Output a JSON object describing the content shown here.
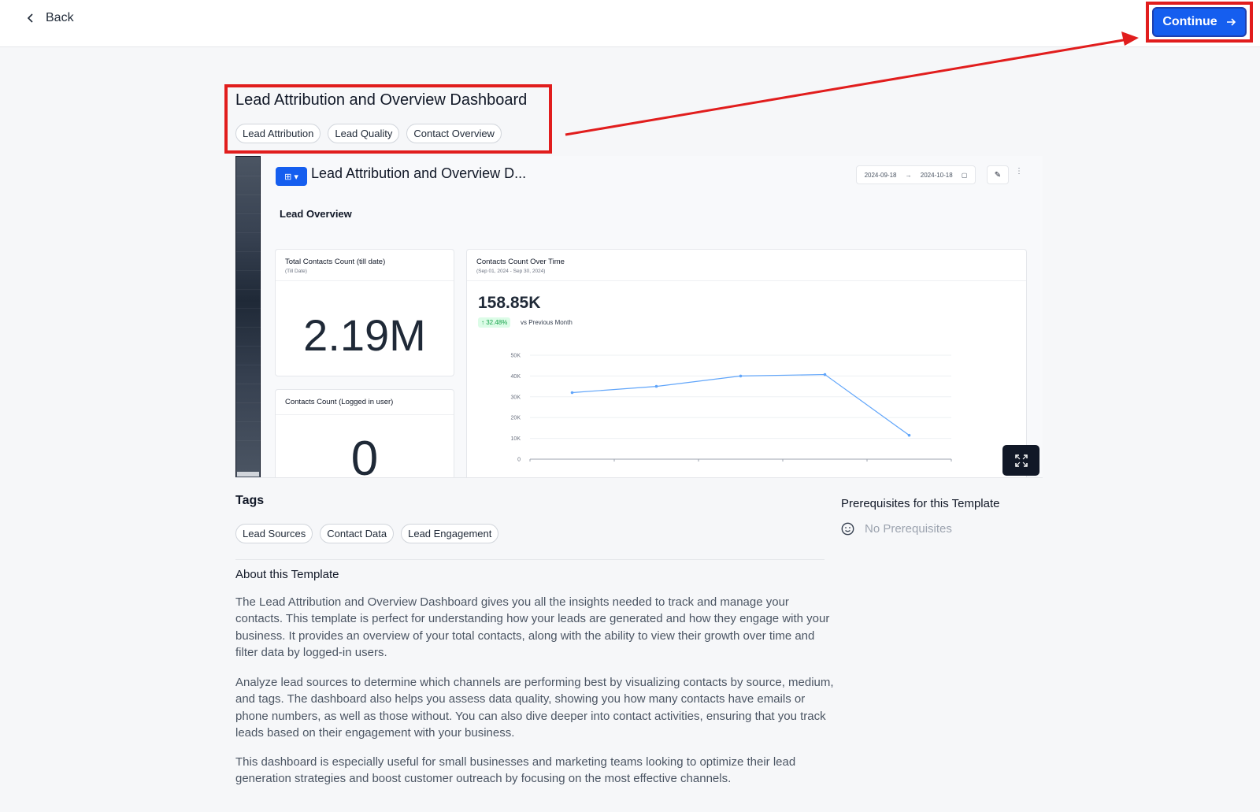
{
  "header": {
    "back_label": "Back",
    "continue_label": "Continue"
  },
  "template": {
    "title": "Lead Attribution and Overview Dashboard",
    "categories": [
      "Lead Attribution",
      "Lead Quality",
      "Contact Overview"
    ]
  },
  "preview": {
    "dashboard_title": "Lead Attribution and Overview D...",
    "date_from": "2024-09-18",
    "date_to": "2024-10-18",
    "section_title": "Lead Overview",
    "card_total": {
      "title": "Total Contacts Count (till date)",
      "subtitle": "(Till Date)",
      "value": "2.19M"
    },
    "card_logged": {
      "title": "Contacts Count (Logged in user)",
      "value": "0"
    },
    "card_chart": {
      "title": "Contacts Count Over Time",
      "subtitle": "(Sep 01, 2024 - Sep 30, 2024)",
      "value": "158.85K",
      "change": "↑ 32.48%",
      "change_label": "vs Previous Month"
    }
  },
  "chart_data": {
    "type": "line",
    "x": [
      1,
      2,
      3,
      4,
      5
    ],
    "series": [
      {
        "values": [
          32000,
          35000,
          40000,
          40700,
          11500
        ]
      }
    ],
    "y_ticks": [
      "50K",
      "40K",
      "30K",
      "20K",
      "10K",
      "0"
    ],
    "ylim": [
      0,
      50000
    ],
    "grid": true,
    "color": "#60a5fa"
  },
  "tags": {
    "heading": "Tags",
    "items": [
      "Lead Sources",
      "Contact Data",
      "Lead Engagement"
    ]
  },
  "about": {
    "heading": "About this Template",
    "paragraphs": [
      "The Lead Attribution and Overview Dashboard gives you all the insights needed to track and manage your contacts. This template is perfect for understanding how your leads are generated and how they engage with your business. It provides an overview of your total contacts, along with the ability to view their growth over time and filter data by logged-in users.",
      "Analyze lead sources to determine which channels are performing best by visualizing contacts by source, medium, and tags. The dashboard also helps you assess data quality, showing you how many contacts have emails or phone numbers, as well as those without. You can also dive deeper into contact activities, ensuring that you track leads based on their engagement with your business.",
      "This dashboard is especially useful for small businesses and marketing teams looking to optimize their lead generation strategies and boost customer outreach by focusing on the most effective channels."
    ]
  },
  "prerequisites": {
    "heading": "Prerequisites for this Template",
    "none_label": "No Prerequisites"
  },
  "colors": {
    "accent": "#155eef",
    "annotation": "#e11d1d"
  }
}
